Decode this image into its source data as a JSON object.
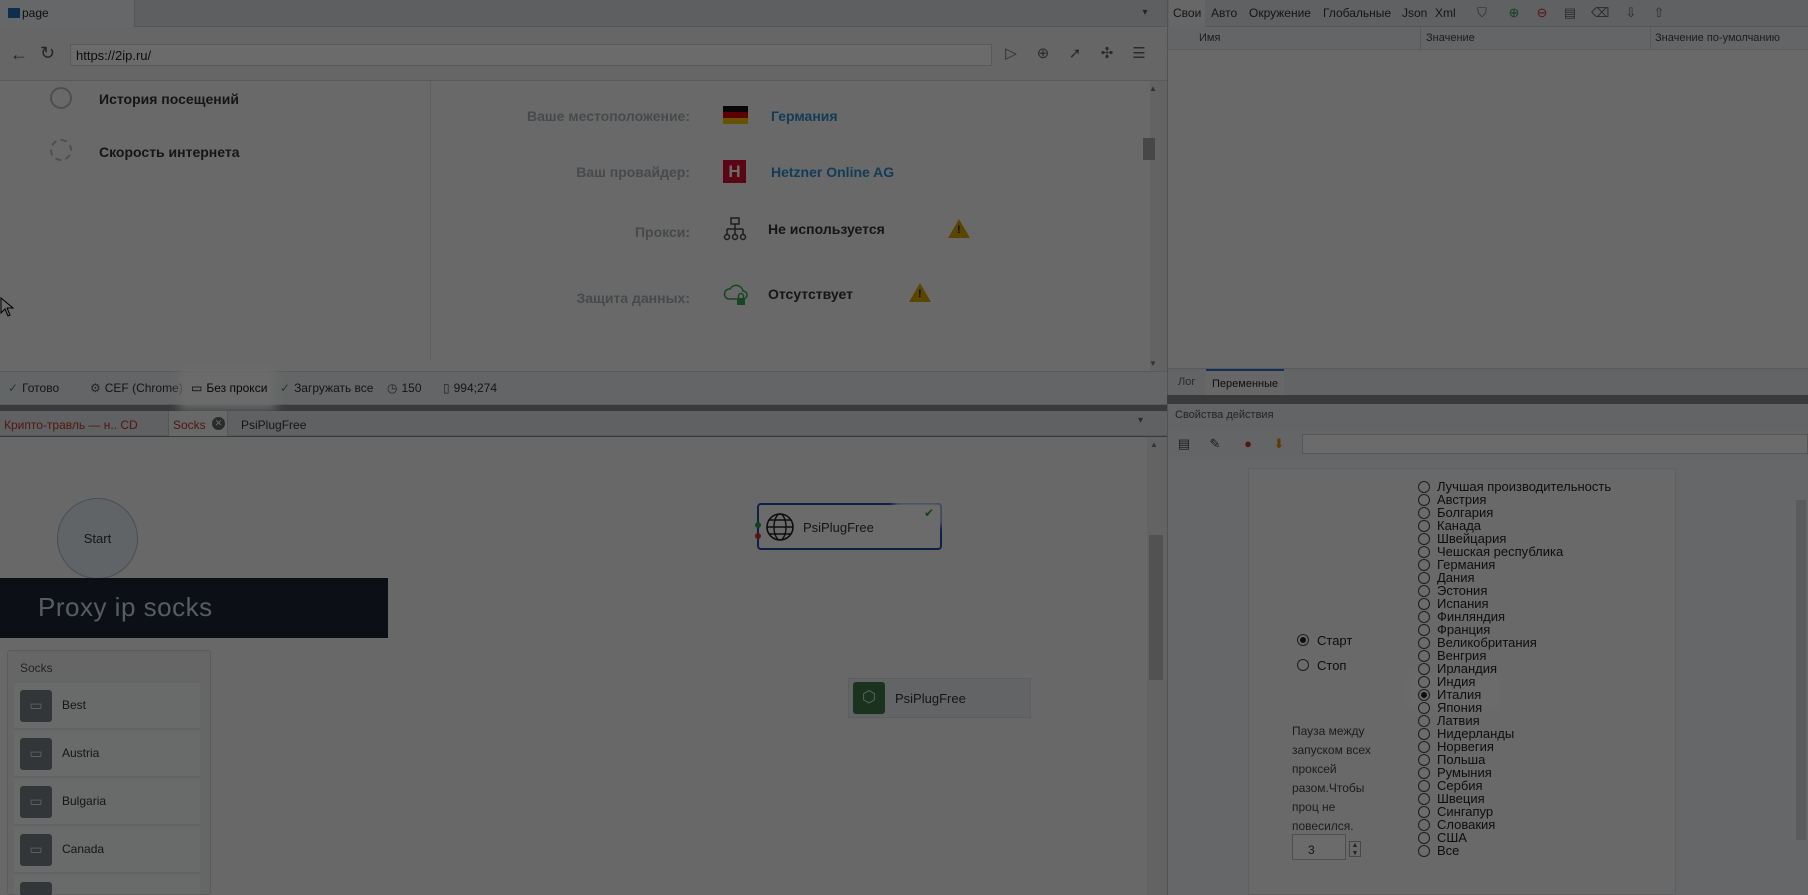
{
  "browser": {
    "tab_title": "page",
    "url": "https://2ip.ru/",
    "sidebar": [
      {
        "label": "История посещений"
      },
      {
        "label": "Скорость интернета"
      }
    ],
    "info": [
      {
        "label": "Ваше местоположение:",
        "value": "Германия"
      },
      {
        "label": "Ваш провайдер:",
        "value": "Hetzner Online AG"
      },
      {
        "label": "Прокси:",
        "value": "Не используется"
      },
      {
        "label": "Защита данных:",
        "value": "Отсутствует"
      }
    ],
    "warn_glyph": "!"
  },
  "statusbar": {
    "ready": "Готово",
    "engine": "CEF (Chrome)",
    "proxy": "Без прокси",
    "load": "Загружать все",
    "timeout": "150",
    "coords": "994;274"
  },
  "scenario_tabs": {
    "tab1": "Крипто-травль — н.. CD",
    "tab2": "Socks",
    "tab3": "PsiPlugFree"
  },
  "canvas": {
    "start": "Start",
    "node1": "PsiPlugFree",
    "node1_check": "✔",
    "node2": "PsiPlugFree",
    "banner": "Proxy ip socks",
    "socks_title": "Socks",
    "socks": [
      "Best",
      "Austria",
      "Bulgaria",
      "Canada"
    ]
  },
  "right": {
    "tabs": [
      "Свои",
      "Авто",
      "Окружение",
      "Глобальные",
      "Json",
      "Xml"
    ],
    "columns": [
      "Имя",
      "Значение",
      "Значение по-умолчанию"
    ],
    "log_tab": "Лог",
    "vars_tab": "Переменные",
    "props_title": "Свойства действия",
    "start_label": "Старт",
    "stop_label": "Стоп",
    "pause_text": "Пауза между запуском всех проксей разом.Чтобы проц не повесился.",
    "pause_value": "3",
    "countries": [
      "Лучшая производительность",
      "Австрия",
      "Болгария",
      "Канада",
      "Швейцария",
      "Чешская республика",
      "Германия",
      "Дания",
      "Эстония",
      "Испания",
      "Финляндия",
      "Франция",
      "Великобритания",
      "Венгрия",
      "Ирландия",
      "Индия",
      "Италия",
      "Япония",
      "Латвия",
      "Нидерланды",
      "Норвегия",
      "Польша",
      "Румыния",
      "Сербия",
      "Швеция",
      "Сингапур",
      "Словакия",
      "США",
      "Все"
    ],
    "selected_country": "Италия",
    "selected_mode": "Старт"
  },
  "colors": {
    "accent_blue": "#2a8fd0",
    "node_border": "#1f4ea8",
    "warning": "#d9a600",
    "banner_bg": "#1c2535"
  }
}
